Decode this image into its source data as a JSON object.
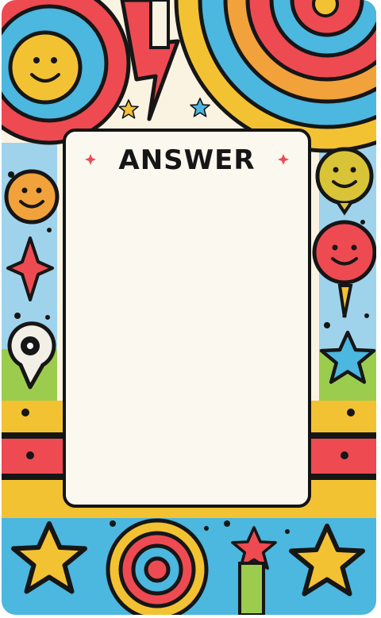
{
  "card": {
    "title": "ANSWER",
    "colors": {
      "yellow": "#f3c233",
      "red": "#ee4a52",
      "blue": "#4cb7df",
      "orange": "#f2a23a",
      "outline": "#161616",
      "panel": "#fbf8ef"
    },
    "icons": [
      "smiley-icon",
      "lightning-bolt-icon",
      "star-icon",
      "balloon-icon",
      "spiral-icon",
      "sparkle-icon"
    ]
  }
}
